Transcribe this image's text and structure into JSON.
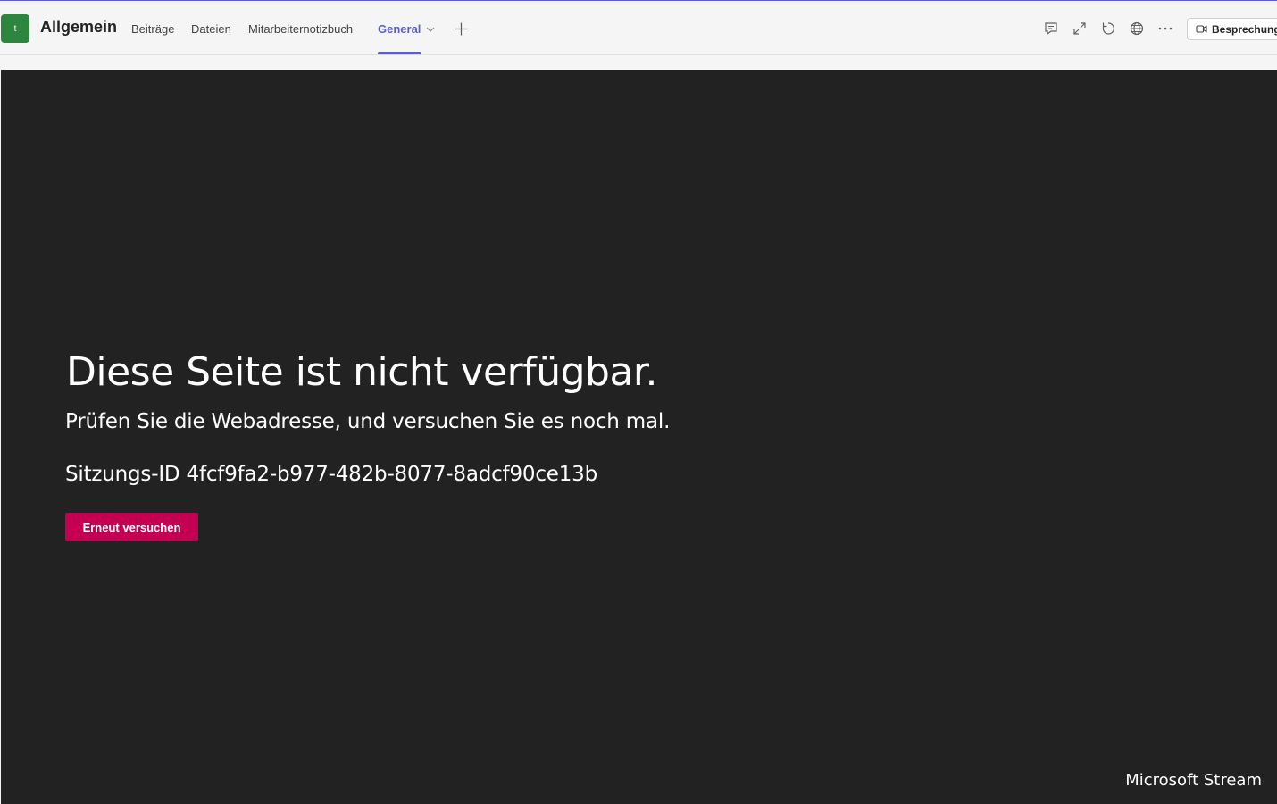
{
  "header": {
    "team_initial": "t",
    "channel_title": "Allgemein",
    "tabs": [
      {
        "label": "Beiträge",
        "active": false
      },
      {
        "label": "Dateien",
        "active": false
      },
      {
        "label": "Mitarbeiternotizbuch",
        "active": false
      },
      {
        "label": "General",
        "active": true
      }
    ],
    "meeting_label": "Besprechung",
    "icons": [
      "conversation-icon",
      "expand-icon",
      "reload-icon",
      "globe-icon",
      "more-icon",
      "video-camera-icon",
      "chevron-down-icon",
      "add-icon"
    ]
  },
  "colors": {
    "accent": "#5b5fc7",
    "team_tile": "#2e8540",
    "content_bg": "#222222",
    "retry_button": "#c30052"
  },
  "error": {
    "title": "Diese Seite ist nicht verfügbar.",
    "subtitle": "Prüfen Sie die Webadresse, und versuchen Sie es noch mal.",
    "session_id": "Sitzungs-ID 4fcf9fa2-b977-482b-8077-8adcf90ce13b",
    "retry_label": "Erneut versuchen"
  },
  "brand": "Microsoft Stream"
}
